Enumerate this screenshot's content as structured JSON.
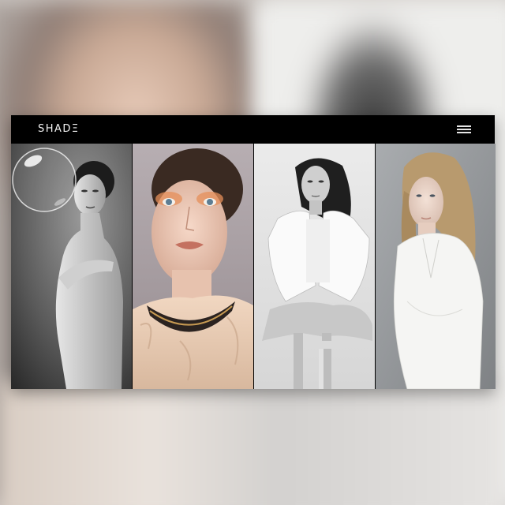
{
  "site": {
    "logo": "SHADΞ",
    "menu_icon": "hamburger-menu-icon"
  },
  "gallery": {
    "panels": [
      {
        "name": "portrait-bw-bubble",
        "tone": "monochrome"
      },
      {
        "name": "portrait-orange-makeup",
        "tone": "color"
      },
      {
        "name": "portrait-white-blazer",
        "tone": "monochrome"
      },
      {
        "name": "portrait-white-shirt",
        "tone": "color"
      }
    ]
  },
  "colors": {
    "nav_background": "#000000",
    "logo_text": "#f2f2f2",
    "backdrop": "#cfcac6"
  }
}
